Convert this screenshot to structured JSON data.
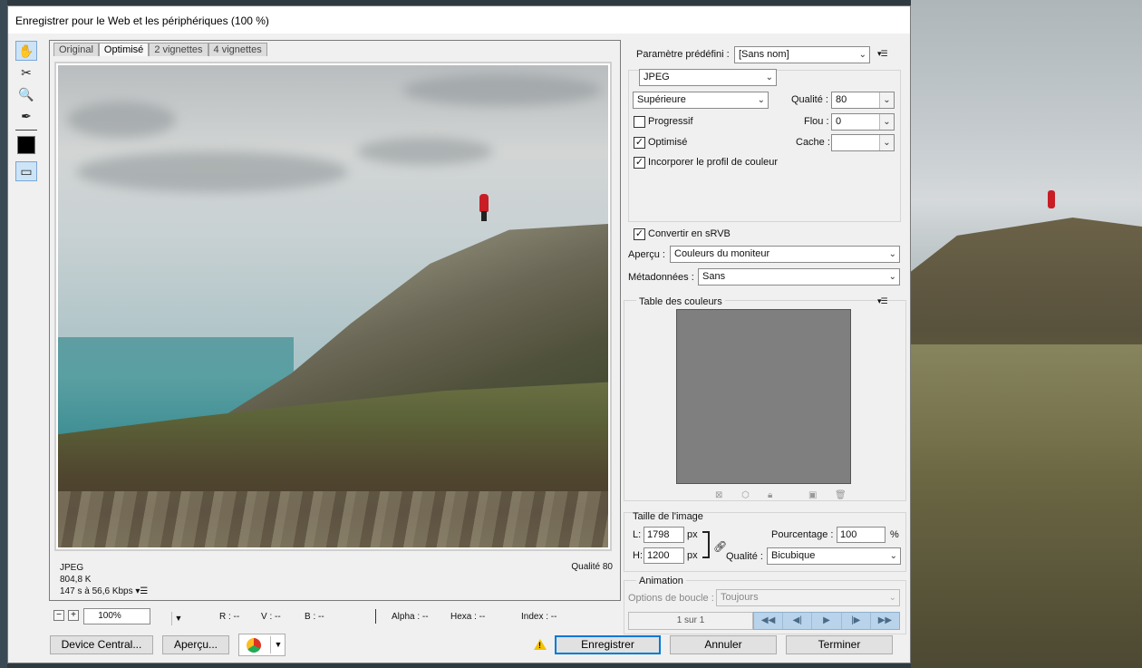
{
  "window": {
    "title": "Enregistrer pour le Web et les périphériques (100 %)"
  },
  "tabs": [
    "Original",
    "Optimisé",
    "2 vignettes",
    "4 vignettes"
  ],
  "preview_info": {
    "format": "JPEG",
    "size": "804,8 K",
    "time": "147 s à 56,6 Kbps",
    "quality": "Qualité 80"
  },
  "statusbar": {
    "zoom": "100%",
    "r": "R : --",
    "v": "V : --",
    "b": "B : --",
    "alpha": "Alpha : --",
    "hexa": "Hexa : --",
    "index": "Index : --"
  },
  "buttons": {
    "device_central": "Device Central...",
    "apercu": "Aperçu...",
    "enregistrer": "Enregistrer",
    "annuler": "Annuler",
    "terminer": "Terminer"
  },
  "settings": {
    "preset_label": "Paramètre prédéfini :",
    "preset_value": "[Sans nom]",
    "format": "JPEG",
    "quality_level": "Supérieure",
    "quality_label": "Qualité :",
    "quality_value": "80",
    "progressive": "Progressif",
    "blur_label": "Flou :",
    "blur_value": "0",
    "optimised": "Optimisé",
    "cache_label": "Cache :",
    "cache_value": "",
    "embed_profile": "Incorporer le profil de couleur",
    "convert_srgb": "Convertir en sRVB",
    "preview_label": "Aperçu :",
    "preview_value": "Couleurs du moniteur",
    "metadata_label": "Métadonnées :",
    "metadata_value": "Sans"
  },
  "color_table": {
    "title": "Table des couleurs"
  },
  "image_size": {
    "title": "Taille de l'image",
    "w_label": "L:",
    "w_value": "1798",
    "h_label": "H:",
    "h_value": "1200",
    "unit": "px",
    "percent_label": "Pourcentage :",
    "percent_value": "100",
    "percent_unit": "%",
    "quality_label": "Qualité :",
    "quality_value": "Bicubique"
  },
  "animation": {
    "title": "Animation",
    "loop_label": "Options de boucle :",
    "loop_value": "Toujours",
    "frame": "1 sur 1"
  }
}
